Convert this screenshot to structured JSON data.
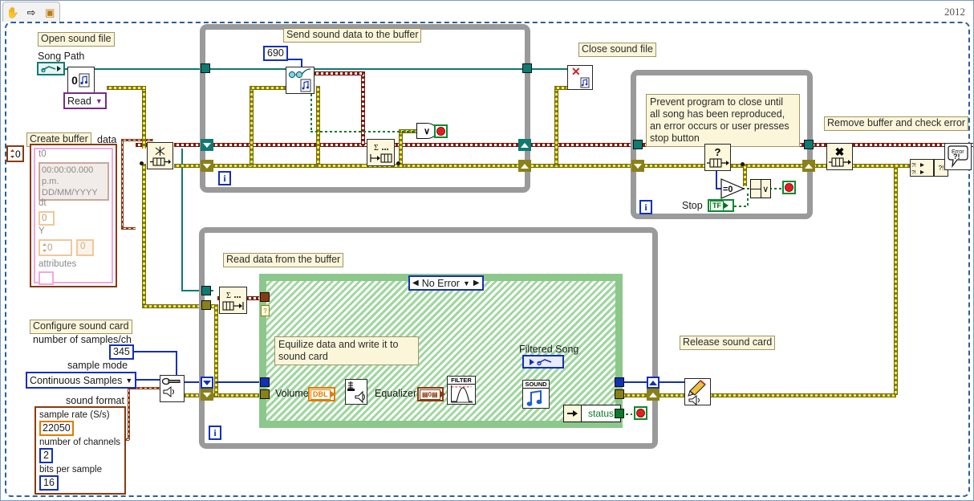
{
  "window": {
    "version_label": "2012",
    "toolbar": {
      "items": [
        {
          "name": "hand-tool-icon",
          "glyph": "✋"
        },
        {
          "name": "arrow-right-icon",
          "glyph": "⇨"
        },
        {
          "name": "connector-pane-icon",
          "glyph": "▣"
        }
      ]
    }
  },
  "labels": {
    "open_sound_file": "Open sound file",
    "song_path": "Song Path",
    "read": "Read",
    "create_buffer": "Create buffer",
    "data": "data",
    "send_sound_data": "Send sound data to the buffer",
    "close_sound_file": "Close sound file",
    "prevent_close_comment": "Prevent program to close until all song has been reproduced, an error occurs or user presses stop button",
    "remove_buffer": "Remove buffer and check error",
    "read_data_from_buffer": "Read data from the buffer",
    "equilize_comment": "Equilize data and write it to sound card",
    "configure_sound_card": "Configure sound card",
    "release_sound_card": "Release sound card",
    "filtered_song": "Filtered Song",
    "stop": "Stop",
    "status": "status",
    "volume": "Volume",
    "equalizer": "Equalizer",
    "no_error": "No Error",
    "number_of_samples_ch": "number of samples/ch",
    "sample_mode": "sample mode",
    "sound_format": "sound format",
    "sample_rate": "sample rate (S/s)",
    "number_of_channels": "number of channels",
    "bits_per_sample": "bits per sample",
    "t0": "t0",
    "t0_value": "00:00:00.000 p.m.",
    "t0_date": "DD/MM/YYYY",
    "dt": "dt",
    "Y": "Y",
    "attributes": "attributes",
    "loop_index": "i",
    "filter_node": "FILTER",
    "sound_node": "SOUND",
    "error_node": "Error",
    "error_node2": "?!",
    "or_symbol": "∨",
    "eq_zero": "=0",
    "zero_icon": "0"
  },
  "values": {
    "buffer_size_index": "0",
    "dt": "0",
    "y_first": "0",
    "y_second": "0",
    "samples_690": "690",
    "samples_per_ch": "345",
    "sample_mode": "Continuous Samples",
    "sample_rate": "22050",
    "num_channels": "2",
    "bits_per_sample": "16"
  },
  "colors": {
    "error_wire": "#8a1c10",
    "dyn_data_wire": "#8a8018",
    "refnum_wire": "#0d7b72",
    "numeric_wire": "#1330b8",
    "bool_wire": "#0a7a2a",
    "loop_frame": "#9a9a9a",
    "case_frame": "#8cc78c",
    "label_bg": "#fbf6d9",
    "node_bg": "#fdf8dc",
    "canvas_bg": "#ffffff",
    "diagram_border": "#2a6099"
  }
}
